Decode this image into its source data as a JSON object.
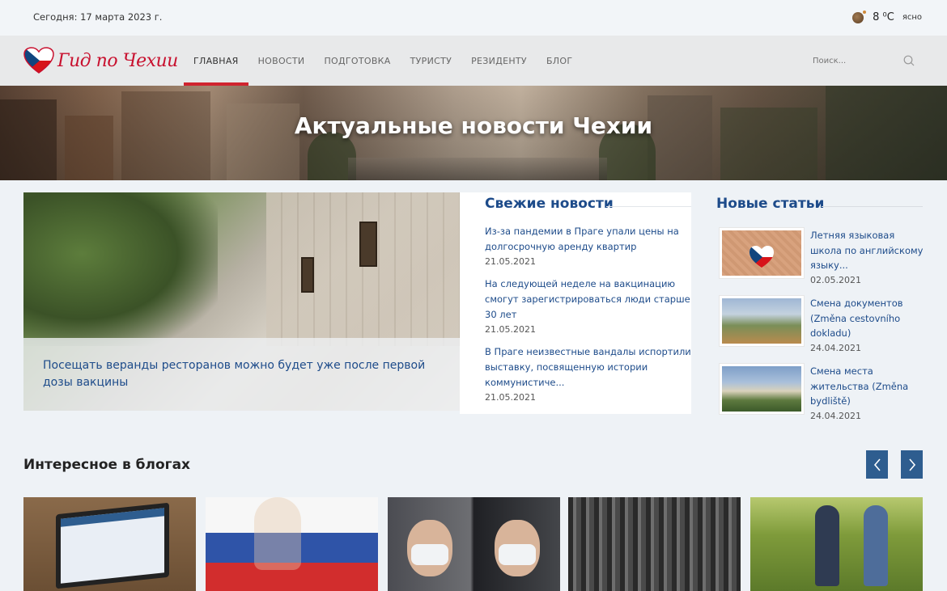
{
  "topbar": {
    "date": "Сегодня: 17 марта 2023 г.",
    "temp": "8",
    "unit": "⁰C",
    "condition": "ясно"
  },
  "logo": {
    "text": "Гид по Чехии"
  },
  "nav": {
    "items": [
      {
        "label": "ГЛАВНАЯ",
        "active": true
      },
      {
        "label": "НОВОСТИ"
      },
      {
        "label": "ПОДГОТОВКА"
      },
      {
        "label": "ТУРИСТУ"
      },
      {
        "label": "РЕЗИДЕНТУ"
      },
      {
        "label": "БЛОГ"
      }
    ]
  },
  "search": {
    "placeholder": "Поиск..."
  },
  "hero": {
    "title": "Актуальные новости Чехии"
  },
  "featured": {
    "caption": "Посещать веранды ресторанов можно будет уже после первой дозы вакцины"
  },
  "fresh": {
    "title": "Свежие новости",
    "items": [
      {
        "title": "Из-за пандемии в Праге упали цены на долгосрочную аренду квартир",
        "date": "21.05.2021"
      },
      {
        "title": "На следующей неделе на вакцинацию смогут зарегистрироваться люди старше 30 лет",
        "date": "21.05.2021"
      },
      {
        "title": "В Праге неизвестные вандалы испортили выставку, посвященную истории коммунистиче...",
        "date": "21.05.2021"
      }
    ]
  },
  "articles": {
    "title": "Новые статьи",
    "items": [
      {
        "title": "Летняя языковая школа по английскому языку...",
        "date": "02.05.2021",
        "image": "heart-flag"
      },
      {
        "title": "Смена документов (Změna cestovního dokladu)",
        "date": "24.04.2021",
        "image": "park-building"
      },
      {
        "title": "Смена места жительства (Změna bydliště)",
        "date": "24.04.2021",
        "image": "palace-garden"
      }
    ]
  },
  "blogs": {
    "title": "Интересное в блогах",
    "prev_icon": "chevron-left-icon",
    "next_icon": "chevron-right-icon",
    "cards": [
      {
        "image": "laptop"
      },
      {
        "image": "flag-hand"
      },
      {
        "image": "politicians-masks"
      },
      {
        "image": "historic-crowd"
      },
      {
        "image": "nordic-walkers"
      }
    ]
  },
  "colors": {
    "brand_red": "#d0242f",
    "link_blue": "#1d4b8a",
    "button_blue": "#2e5d8f"
  }
}
